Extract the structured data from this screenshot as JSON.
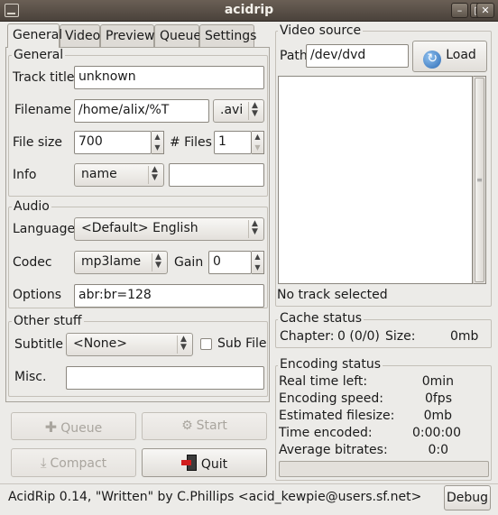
{
  "window": {
    "title": "acidrip"
  },
  "tabs": [
    {
      "label": "General"
    },
    {
      "label": "Video"
    },
    {
      "label": "Preview"
    },
    {
      "label": "Queue"
    },
    {
      "label": "Settings"
    }
  ],
  "general": {
    "frame_label": "General",
    "track_title": {
      "label": "Track title",
      "value": "unknown"
    },
    "filename": {
      "label": "Filename",
      "value": "/home/alix/%T",
      "extension": ".avi"
    },
    "file_size": {
      "label": "File size",
      "value": "700"
    },
    "files": {
      "label": "# Files",
      "value": "1"
    },
    "info": {
      "label": "Info",
      "selected": "name",
      "value": ""
    }
  },
  "audio": {
    "frame_label": "Audio",
    "language": {
      "label": "Language",
      "selected": "<Default> English"
    },
    "codec": {
      "label": "Codec",
      "selected": "mp3lame"
    },
    "gain": {
      "label": "Gain",
      "value": "0"
    },
    "options": {
      "label": "Options",
      "value": "abr:br=128"
    }
  },
  "other": {
    "frame_label": "Other stuff",
    "subtitle": {
      "label": "Subtitle",
      "selected": "<None>"
    },
    "sub_file": {
      "label": "Sub File",
      "checked": false
    },
    "misc": {
      "label": "Misc.",
      "value": ""
    }
  },
  "actions": {
    "queue": "Queue",
    "start": "Start",
    "compact": "Compact",
    "quit": "Quit"
  },
  "video_source": {
    "frame_label": "Video source",
    "path_label": "Path",
    "path_value": "/dev/dvd",
    "load_label": "Load",
    "status": "No track selected"
  },
  "cache_status": {
    "frame_label": "Cache status",
    "chapter_label": "Chapter:",
    "chapter_value": "0 (0/0)",
    "size_label": "Size:",
    "size_value": "0mb"
  },
  "encoding_status": {
    "frame_label": "Encoding status",
    "rows": [
      {
        "label": "Real time left:",
        "value": "0min"
      },
      {
        "label": "Encoding speed:",
        "value": "0fps"
      },
      {
        "label": "Estimated filesize:",
        "value": "0mb"
      },
      {
        "label": "Time encoded:",
        "value": "0:00:00"
      },
      {
        "label": "Average bitrates:",
        "value": "0:0"
      }
    ],
    "progress": 0
  },
  "statusbar": {
    "text": "AcidRip 0.14, \"Written\" by C.Phillips <acid_kewpie@users.sf.net>",
    "debug_label": "Debug"
  }
}
